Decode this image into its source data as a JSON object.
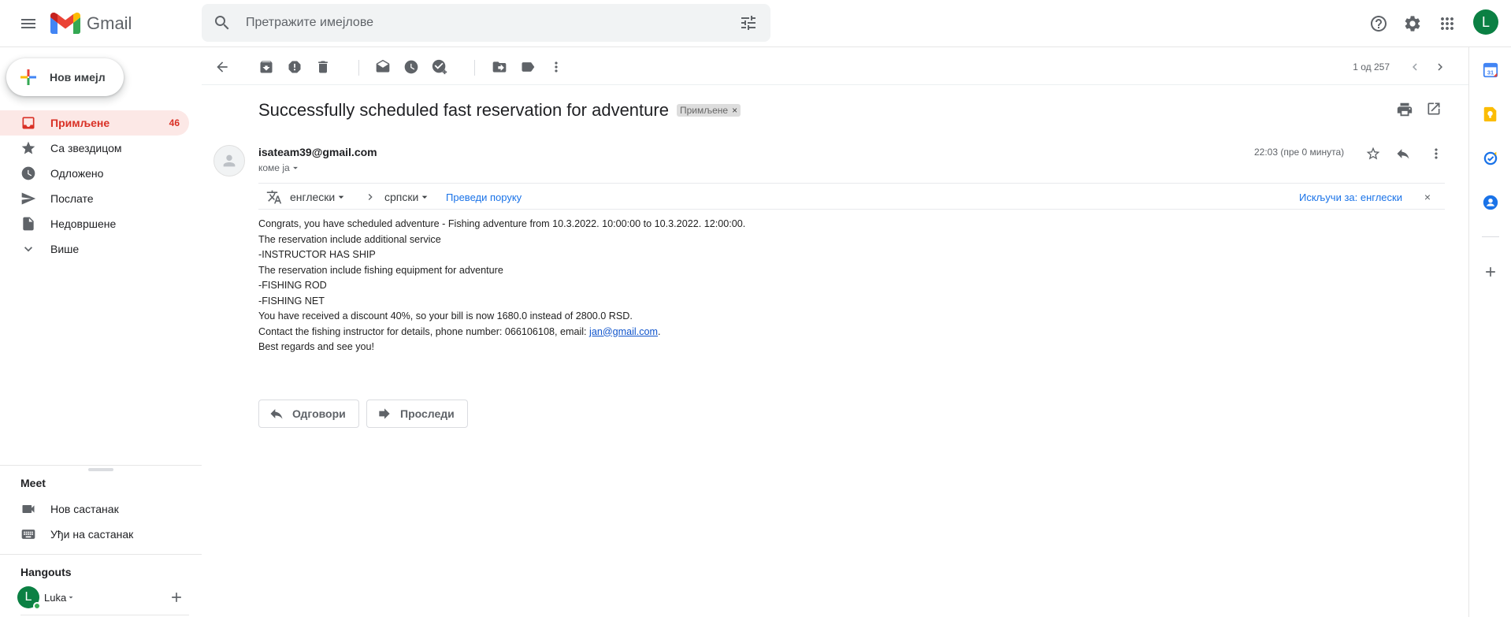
{
  "header": {
    "app_name": "Gmail",
    "search_placeholder": "Претражите имејлове",
    "avatar_letter": "L"
  },
  "compose": {
    "label": "Нов имејл"
  },
  "nav": {
    "items": [
      {
        "label": "Примљене",
        "count": "46",
        "icon": "inbox-icon",
        "active": true
      },
      {
        "label": "Са звездицом",
        "icon": "star-icon"
      },
      {
        "label": "Одложено",
        "icon": "clock-icon"
      },
      {
        "label": "Послате",
        "icon": "send-icon"
      },
      {
        "label": "Недовршене",
        "icon": "draft-icon"
      },
      {
        "label": "Више",
        "icon": "chevron-down-icon"
      }
    ]
  },
  "meet": {
    "title": "Meet",
    "new_meeting": "Нов састанак",
    "join_meeting": "Уђи на састанак"
  },
  "hangouts": {
    "title": "Hangouts",
    "user_name": "Luka",
    "user_letter": "L"
  },
  "toolbar": {
    "pager_text": "1 од 257"
  },
  "message": {
    "subject": "Successfully scheduled fast reservation for adventure",
    "label_chip": "Примљене",
    "sender": "isateam39@gmail.com",
    "to": "коме ја",
    "time": "22:03 (пре 0 минута)",
    "body_lines": [
      "Congrats, you have scheduled adventure - Fishing adventure from 10.3.2022. 10:00:00 to 10.3.2022. 12:00:00.",
      "The reservation include additional service",
      "-INSTRUCTOR HAS SHIP",
      "The reservation include fishing equipment for adventure",
      "-FISHING ROD",
      "-FISHING NET",
      "You have received a discount 40%, so your bill is now 1680.0 instead of 2800.0 RSD."
    ],
    "contact_prefix": "Contact the fishing instructor for details, phone number: 066106108, email: ",
    "contact_email": "jan@gmail.com",
    "contact_suffix": ".",
    "closing": "Best regards and see you!"
  },
  "translate": {
    "from_lang": "енглески",
    "to_lang": "српски",
    "translate_link": "Преведи поруку",
    "turn_off": "Искључи за: енглески",
    "close": "×"
  },
  "actions": {
    "reply": "Одговори",
    "forward": "Проследи"
  },
  "colors": {
    "accent_red": "#d93025",
    "active_bg": "#fce8e6",
    "link_blue": "#1a73e8"
  }
}
